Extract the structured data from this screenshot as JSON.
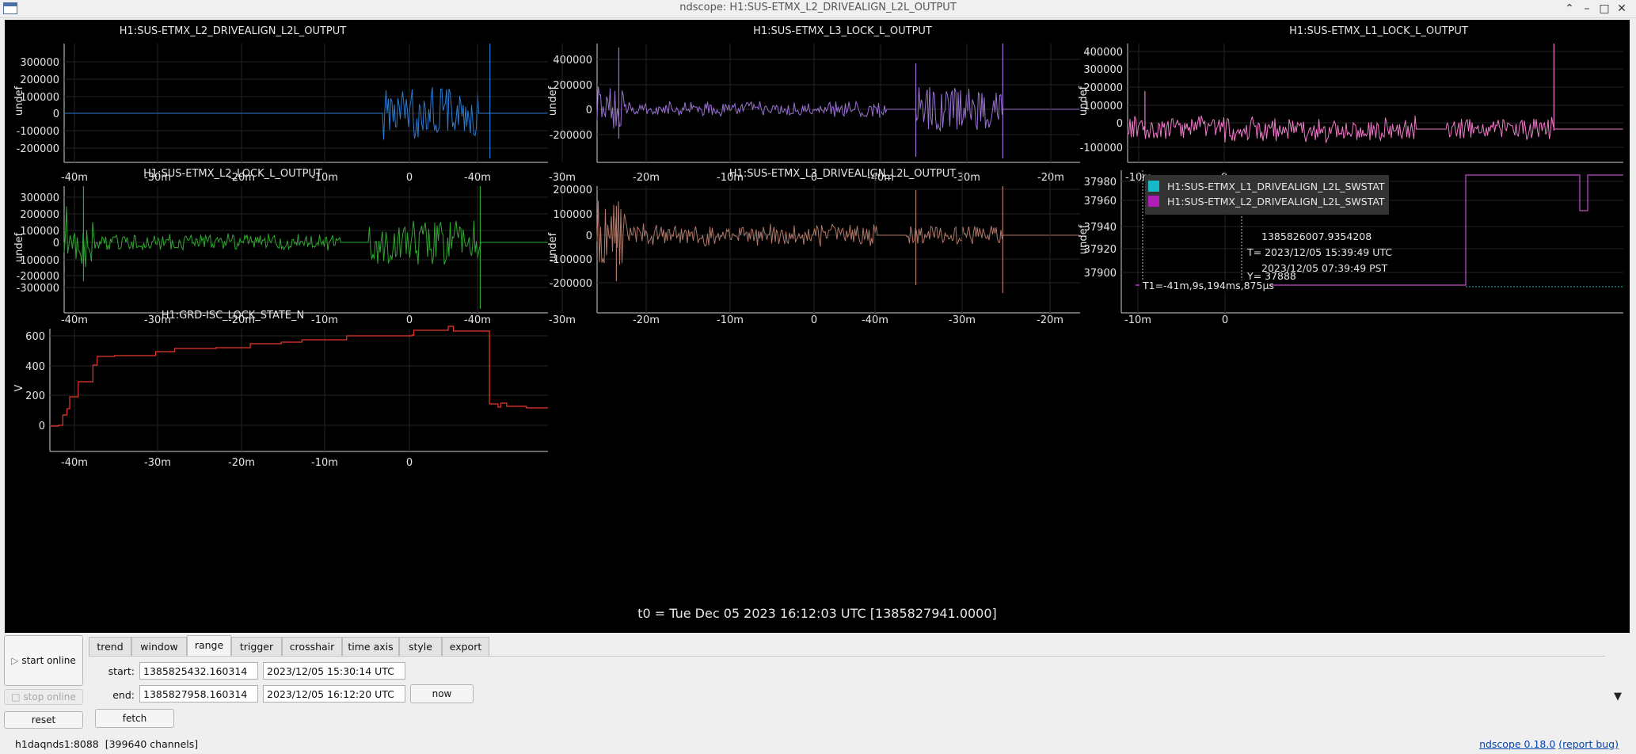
{
  "window": {
    "title": "ndscope: H1:SUS-ETMX_L2_DRIVEALIGN_L2L_OUTPUT"
  },
  "plot_area": {
    "t0_label": "t0 = Tue Dec 05 2023 16:12:03 UTC [1385827941.0000]"
  },
  "plots": [
    {
      "title": "H1:SUS-ETMX_L2_DRIVEALIGN_L2L_OUTPUT",
      "ylabel": "undef",
      "color": "#2b7bd1",
      "yticks": [
        "300000",
        "200000",
        "100000",
        "0",
        "-100000",
        "-200000"
      ],
      "xticks": [
        "-40m",
        "-30m",
        "-20m",
        "-10m",
        "0"
      ]
    },
    {
      "title": "H1:SUS-ETMX_L3_LOCK_L_OUTPUT",
      "ylabel": "undef",
      "color": "#9a72d4",
      "yticks": [
        "400000",
        "200000",
        "0",
        "-200000"
      ],
      "xticks": [
        "-40m",
        "-30m",
        "-20m",
        "-10m",
        "0"
      ]
    },
    {
      "title": "H1:SUS-ETMX_L1_LOCK_L_OUTPUT",
      "ylabel": "undef",
      "color": "#f07ac8",
      "yticks": [
        "400000",
        "300000",
        "200000",
        "100000",
        "0",
        "-100000"
      ],
      "xticks": [
        "-40m",
        "-30m",
        "-20m",
        "-10m",
        "0"
      ]
    },
    {
      "title": "H1:SUS-ETMX_L2_LOCK_L_OUTPUT",
      "ylabel": "undef",
      "color": "#2fa82f",
      "yticks": [
        "300000",
        "200000",
        "100000",
        "0",
        "-100000",
        "-200000",
        "-300000"
      ],
      "xticks": [
        "-40m",
        "-30m",
        "-20m",
        "-10m",
        "0"
      ]
    },
    {
      "title": "H1:SUS-ETMX_L3_DRIVEALIGN_L2L_OUTPUT",
      "ylabel": "undef",
      "color": "#b07868",
      "yticks": [
        "200000",
        "100000",
        "0",
        "-100000",
        "-200000"
      ],
      "xticks": [
        "-40m",
        "-30m",
        "-20m",
        "-10m",
        "0"
      ]
    },
    {
      "title": "",
      "ylabel": "undef",
      "color": "#c050c8",
      "yticks": [
        "37980",
        "37960",
        "37940",
        "37920",
        "37900"
      ],
      "xticks": [
        "-40m",
        "-30m",
        "-20m",
        "-10m",
        "0"
      ],
      "legend": [
        {
          "label": "H1:SUS-ETMX_L1_DRIVEALIGN_L2L_SWSTAT",
          "color": "#17b8c7"
        },
        {
          "label": "H1:SUS-ETMX_L2_DRIVEALIGN_L2L_SWSTAT",
          "color": "#b01cb8"
        }
      ],
      "cursor": {
        "gps": "1385826007.9354208",
        "t_utc": "T= 2023/12/05 15:39:49 UTC",
        "t_pst": "2023/12/05 07:39:49 PST",
        "y": "Y= 37888",
        "t1": "T1=-41m,9s,194ms,875μs"
      }
    },
    {
      "title": "H1:GRD-ISC_LOCK_STATE_N",
      "ylabel": "V",
      "color": "#e8382c",
      "yticks": [
        "600",
        "400",
        "200",
        "0"
      ],
      "xticks": [
        "-40m",
        "-30m",
        "-20m",
        "-10m",
        "0"
      ]
    }
  ],
  "controls": {
    "start_online": "start online",
    "stop_online": "stop online",
    "reset": "reset",
    "fetch": "fetch",
    "now": "now",
    "tabs": [
      "trend",
      "window",
      "range",
      "trigger",
      "crosshair",
      "time axis",
      "style",
      "export"
    ],
    "active_tab": "range",
    "start_label": "start:",
    "end_label": "end:",
    "start_gps": "1385825432.160314",
    "start_utc": "2023/12/05 15:30:14 UTC",
    "end_gps": "1385827958.160314",
    "end_utc": "2023/12/05 16:12:20 UTC"
  },
  "status": {
    "server": "h1daqnds1:8088",
    "channels": "[399640 channels]",
    "version": "ndscope 0.18.0",
    "report_bug": "(report bug)"
  }
}
